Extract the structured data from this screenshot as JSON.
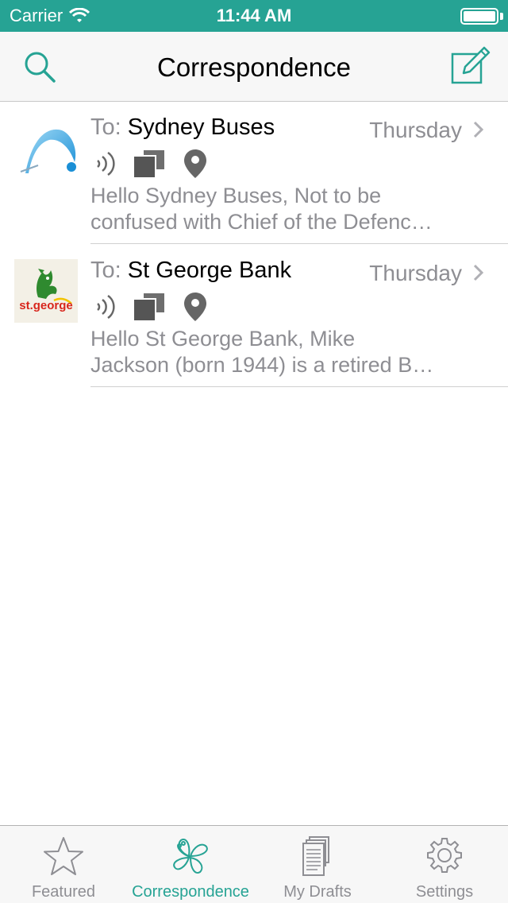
{
  "status_bar": {
    "carrier": "Carrier",
    "time": "11:44 AM"
  },
  "nav": {
    "title": "Correspondence"
  },
  "messages": [
    {
      "to_prefix": "To:",
      "recipient": "Sydney Buses",
      "date": "Thursday",
      "preview_line1": "Hello Sydney Buses,  Not to be",
      "preview_line2": "confused with Chief of the Defenc…",
      "logo": "sydney-buses-logo"
    },
    {
      "to_prefix": "To:",
      "recipient": "St George Bank",
      "date": "Thursday",
      "preview_line1": "Hello St George Bank,  Mike",
      "preview_line2": "Jackson (born 1944) is a retired B…",
      "logo": "st-george-logo",
      "logo_text": "st.george"
    }
  ],
  "tabs": [
    {
      "label": "Featured",
      "icon": "star-icon"
    },
    {
      "label": "Correspondence",
      "icon": "hibiscus-icon",
      "active": true
    },
    {
      "label": "My Drafts",
      "icon": "drafts-icon"
    },
    {
      "label": "Settings",
      "icon": "gear-icon"
    }
  ],
  "colors": {
    "accent": "#26a394",
    "muted": "#8e8e93"
  }
}
